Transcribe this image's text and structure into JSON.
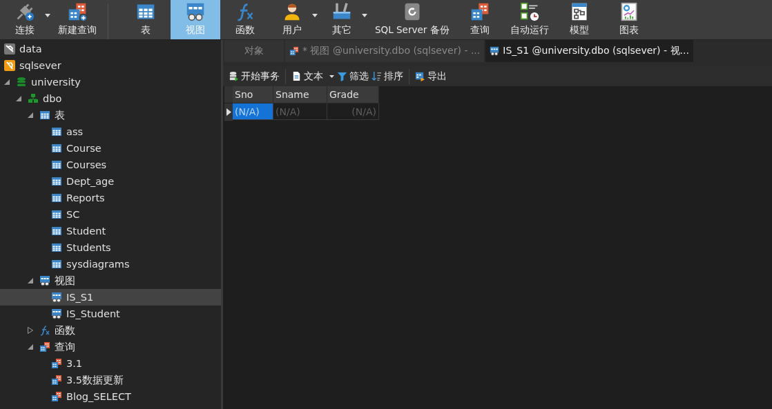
{
  "toolbar": [
    {
      "label": "连接",
      "kind": "connect",
      "selected": false,
      "dropdown": true
    },
    {
      "label": "新建查询",
      "kind": "new-query",
      "selected": false,
      "separator_after": true
    },
    {
      "label": "表",
      "kind": "table",
      "selected": false,
      "dropdown": false
    },
    {
      "label": "视图",
      "kind": "view",
      "selected": true,
      "dropdown": false
    },
    {
      "label": "函数",
      "kind": "function",
      "selected": false,
      "dropdown": false
    },
    {
      "label": "用户",
      "kind": "user",
      "selected": false,
      "dropdown": true
    },
    {
      "label": "其它",
      "kind": "tools",
      "selected": false,
      "dropdown": true
    },
    {
      "label": "SQL Server 备份",
      "kind": "backup",
      "selected": false,
      "dropdown": false
    },
    {
      "label": "查询",
      "kind": "query",
      "selected": false,
      "dropdown": false
    },
    {
      "label": "自动运行",
      "kind": "schedule",
      "selected": false,
      "dropdown": false
    },
    {
      "label": "模型",
      "kind": "model",
      "selected": false,
      "dropdown": false
    },
    {
      "label": "图表",
      "kind": "chart",
      "selected": false,
      "dropdown": false
    }
  ],
  "sidebar": {
    "tree": [
      {
        "label": "data",
        "kind": "connection-off",
        "selected": false
      },
      {
        "label": "sqlsever",
        "kind": "connection",
        "selected": false,
        "children": [
          {
            "label": "university",
            "kind": "database",
            "selected": false,
            "expanded": true,
            "children": [
              {
                "label": "dbo",
                "kind": "schema",
                "selected": false,
                "expanded": true,
                "children": [
                  {
                    "label": "表",
                    "kind": "table",
                    "selected": false,
                    "expanded": true,
                    "children": [
                      {
                        "label": "ass",
                        "kind": "table",
                        "selected": false
                      },
                      {
                        "label": "Course",
                        "kind": "table",
                        "selected": false
                      },
                      {
                        "label": "Courses",
                        "kind": "table",
                        "selected": false
                      },
                      {
                        "label": "Dept_age",
                        "kind": "table",
                        "selected": false
                      },
                      {
                        "label": "Reports",
                        "kind": "table",
                        "selected": false
                      },
                      {
                        "label": "SC",
                        "kind": "table",
                        "selected": false
                      },
                      {
                        "label": "Student",
                        "kind": "table",
                        "selected": false
                      },
                      {
                        "label": "Students",
                        "kind": "table",
                        "selected": false
                      },
                      {
                        "label": "sysdiagrams",
                        "kind": "table",
                        "selected": false
                      }
                    ]
                  },
                  {
                    "label": "视图",
                    "kind": "view",
                    "selected": false,
                    "expanded": true,
                    "children": [
                      {
                        "label": "IS_S1",
                        "kind": "view",
                        "selected": true
                      },
                      {
                        "label": "IS_Student",
                        "kind": "view",
                        "selected": false
                      }
                    ]
                  },
                  {
                    "label": "函数",
                    "kind": "function",
                    "selected": false,
                    "expanded": false
                  },
                  {
                    "label": "查询",
                    "kind": "query",
                    "selected": false,
                    "expanded": true,
                    "children": [
                      {
                        "label": "3.1",
                        "kind": "query",
                        "selected": false
                      },
                      {
                        "label": "3.5数据更新",
                        "kind": "query",
                        "selected": false
                      },
                      {
                        "label": "Blog_SELECT",
                        "kind": "query",
                        "selected": false
                      }
                    ]
                  }
                ]
              }
            ]
          }
        ]
      }
    ]
  },
  "tabs": [
    {
      "label": "对象",
      "selected": false
    },
    {
      "label": "* 视图 @university.dbo (sqlsever) - ...",
      "kind": "query",
      "selected": false
    },
    {
      "label": "IS_S1 @university.dbo (sqlsever) - 视...",
      "kind": "view",
      "selected": true
    }
  ],
  "actions": [
    {
      "label": "开始事务",
      "kind": "transaction",
      "separator_after": true
    },
    {
      "label": "文本",
      "kind": "text",
      "dropdown": true
    },
    {
      "label": "筛选",
      "kind": "filter"
    },
    {
      "label": "排序",
      "kind": "sort",
      "separator_after": true
    },
    {
      "label": "导出",
      "kind": "export"
    }
  ],
  "grid": {
    "columns": [
      {
        "label": "Sno"
      },
      {
        "label": "Sname"
      },
      {
        "label": "Grade"
      }
    ],
    "rows": [
      {
        "current": true,
        "cells": [
          {
            "value": "(N/A)",
            "selected": true
          },
          {
            "value": "(N/A)",
            "selected": false
          },
          {
            "value": "(N/A)",
            "selected": false
          }
        ]
      }
    ]
  }
}
